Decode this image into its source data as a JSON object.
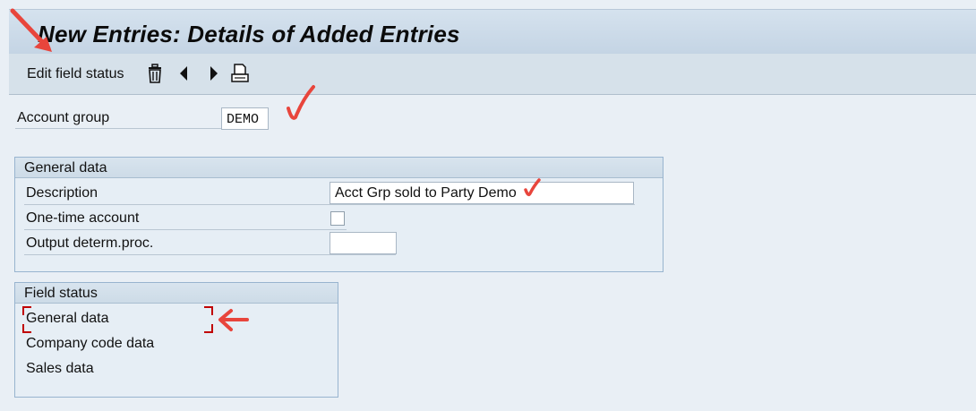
{
  "header": {
    "title": "New Entries: Details of Added Entries"
  },
  "toolbar": {
    "edit_field_status": "Edit field status",
    "icons": [
      "trash-icon",
      "previous-icon",
      "next-icon",
      "print-icon"
    ]
  },
  "account_group": {
    "label": "Account group",
    "value": "DEMO"
  },
  "general_data": {
    "title": "General data",
    "description_label": "Description",
    "description_value": "Acct Grp sold to Party Demo",
    "one_time_label": "One-time account",
    "one_time_checked": false,
    "output_label": "Output determ.proc.",
    "output_value": ""
  },
  "field_status": {
    "title": "Field status",
    "items": [
      "General data",
      "Company code data",
      "Sales data"
    ]
  },
  "annotation_color": "#e8453c"
}
